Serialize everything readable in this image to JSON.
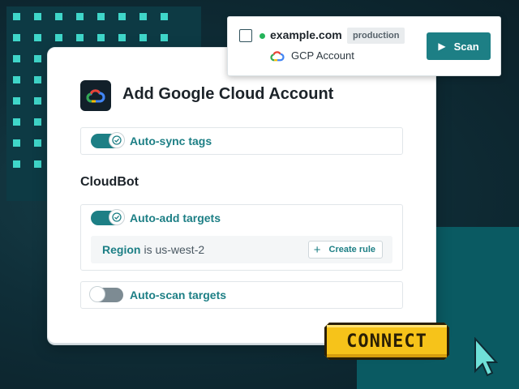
{
  "card": {
    "title": "Add Google Cloud Account",
    "auto_sync": {
      "label": "Auto-sync tags",
      "enabled": true
    },
    "section_title": "CloudBot",
    "auto_add": {
      "label": "Auto-add targets",
      "enabled": true,
      "rule": {
        "key": "Region",
        "value": "is us-west-2"
      },
      "create_rule_label": "Create rule"
    },
    "auto_scan": {
      "label": "Auto-scan targets",
      "enabled": false
    }
  },
  "target": {
    "domain": "example.com",
    "environment": "production",
    "account": "GCP Account",
    "status_color": "#25b35a",
    "scan_label": "Scan"
  },
  "connect_label": "CONNECT",
  "colors": {
    "accent": "#1d7f85",
    "connect_yellow": "#f6c31a",
    "dots": "#3fd6c9"
  },
  "icons": [
    "gcp-logo-icon",
    "check-icon",
    "plus-icon",
    "play-icon",
    "cursor-icon"
  ]
}
